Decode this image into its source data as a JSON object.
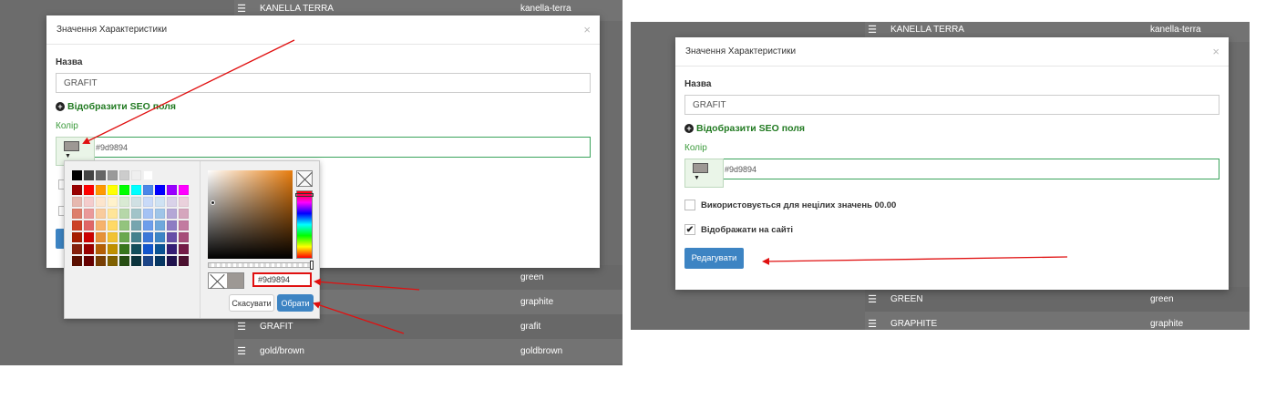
{
  "left": {
    "rows_top": [
      {
        "name": "KANELLA TERRA",
        "slug": "kanella-terra"
      }
    ],
    "rows_bottom": [
      {
        "name": "",
        "slug": "green"
      },
      {
        "name": "",
        "slug": "graphite"
      },
      {
        "name": "GRAFIT",
        "slug": "grafit"
      },
      {
        "name": "gold/brown",
        "slug": "goldbrown"
      }
    ],
    "modal": {
      "title": "Значення Характеристики",
      "close": "×",
      "name_label": "Назва",
      "name_value": "GRAFIT",
      "seo_link": "Відобразити SEO поля",
      "color_label": "Колір",
      "color_value": "#9d9894",
      "color_swatch": "#9d9894"
    },
    "picker": {
      "hex_value": "#9d9894",
      "cancel_label": "Скасувати",
      "choose_label": "Обрати",
      "palette": [
        [
          "#000000",
          "#434343",
          "#666666",
          "#999999",
          "#cccccc",
          "#efefef",
          "#ffffff"
        ],
        [
          "#980000",
          "#ff0000",
          "#ff9900",
          "#ffff00",
          "#00ff00",
          "#00ffff",
          "#4a86e8",
          "#0000ff",
          "#9900ff",
          "#ff00ff"
        ],
        [
          "#e6b8af",
          "#f4cccc",
          "#fce5cd",
          "#fff2cc",
          "#d9ead3",
          "#d0e0e3",
          "#c9daf8",
          "#cfe2f3",
          "#d9d2e9",
          "#ead1dc"
        ],
        [
          "#dd7e6b",
          "#ea9999",
          "#f9cb9c",
          "#ffe599",
          "#b6d7a8",
          "#a2c4c9",
          "#a4c2f4",
          "#9fc5e8",
          "#b4a7d6",
          "#d5a6bd"
        ],
        [
          "#cc4125",
          "#e06666",
          "#f6b26b",
          "#ffd966",
          "#93c47d",
          "#76a5af",
          "#6d9eeb",
          "#6fa8dc",
          "#8e7cc3",
          "#c27ba0"
        ],
        [
          "#a61c00",
          "#cc0000",
          "#e69138",
          "#f1c232",
          "#6aa84f",
          "#45818e",
          "#3c78d8",
          "#3d85c6",
          "#674ea7",
          "#a64d79"
        ],
        [
          "#85200c",
          "#990000",
          "#b45f06",
          "#bf9000",
          "#38761d",
          "#134f5c",
          "#1155cc",
          "#0b5394",
          "#351c75",
          "#741b47"
        ],
        [
          "#5b0f00",
          "#660000",
          "#783f04",
          "#7f6000",
          "#274e13",
          "#0c343d",
          "#1c4587",
          "#073763",
          "#20124d",
          "#4c1130"
        ]
      ]
    }
  },
  "right": {
    "rows_top": [
      {
        "name": "KANELLA TERRA",
        "slug": "kanella-terra"
      }
    ],
    "rows_bottom": [
      {
        "name": "GREEN",
        "slug": "green"
      },
      {
        "name": "GRAPHITE",
        "slug": "graphite"
      }
    ],
    "modal": {
      "title": "Значення Характеристики",
      "close": "×",
      "name_label": "Назва",
      "name_value": "GRAFIT",
      "seo_link": "Відобразити SEO поля",
      "color_label": "Колір",
      "color_value": "#9d9894",
      "color_swatch": "#9d9894",
      "check1_label": "Використовується для нецілих значень 00.00",
      "check1_checked": false,
      "check2_label": "Відображати на сайті",
      "check2_checked": true,
      "submit_label": "Редагувати"
    }
  },
  "colors": {
    "overlay": "#6c6c6c",
    "accent_green": "#3aa35b",
    "primary_button": "#3d84c3",
    "annotation_arrow": "#e01010"
  },
  "icons": [
    "hamburger-icon",
    "close-icon",
    "plus-circle-icon",
    "dropdown-triangle-icon",
    "checkmark-icon",
    "no-color-icon"
  ]
}
